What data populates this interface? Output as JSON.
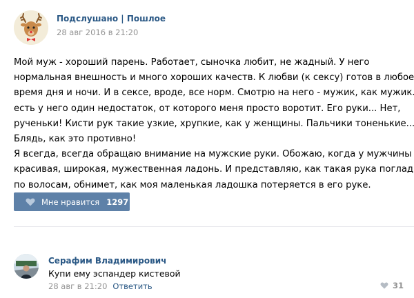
{
  "post": {
    "author": "Подслушано | Пошлое",
    "date": "28 авг 2016 в 21:20",
    "lines": [
      "Мой муж - хороший парень. Работает, сыночка любит, не жадный. У него",
      "нормальная внешность и много хороших качеств. К любви (к сексу) готов в любое",
      "время дня и ночи. И в сексе, вроде, все норм. Смотрю на него - мужик, как мужик. Но",
      "есть у него один недостаток, от которого меня просто воротит. Его руки... Нет,",
      "рученьки! Кисти рук такие узкие, хрупкие, как у женщины. Пальчики тоненькие...",
      "Блядь, как это противно!",
      "Я всегда, всегда обращаю внимание на мужские руки. Обожаю, когда у мужчины",
      "красивая, широкая, мужественная ладонь. И представляю, как такая рука погладит",
      "по волосам, обнимет, как моя маленькая ладошка потеряется в его руке."
    ],
    "like_label": "Мне нравится",
    "like_count": "1297",
    "colors": {
      "accent": "#5e81a8",
      "link": "#2a5885",
      "muted": "#939393"
    }
  },
  "comment": {
    "author": "Серафим Владимирович",
    "text": "Купи ему эспандер кистевой",
    "date": "28 авг в 21:20",
    "reply_label": "Ответить",
    "like_count": "31"
  }
}
